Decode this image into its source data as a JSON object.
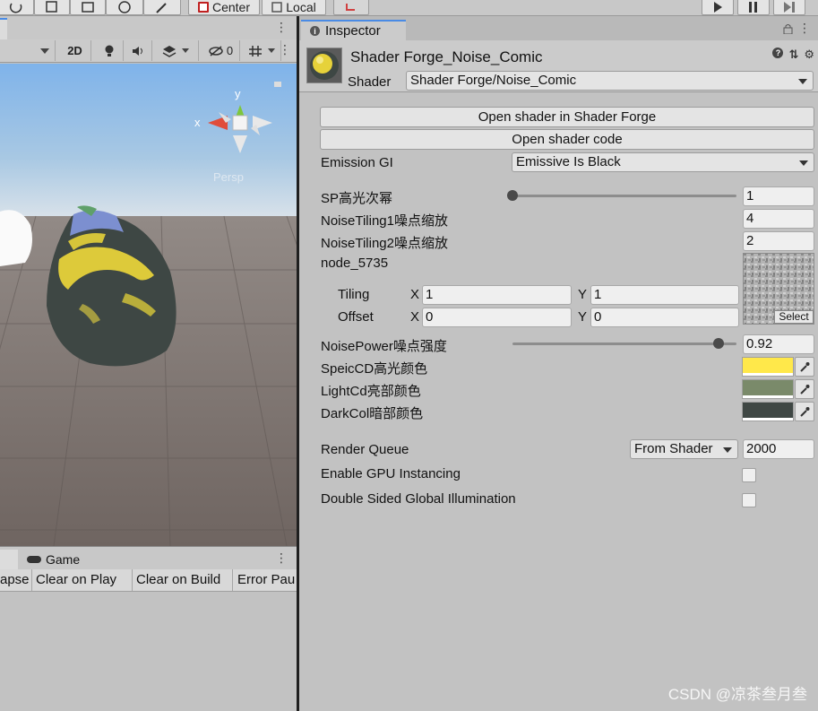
{
  "toolbar": {
    "pivot_center_label": "Center",
    "pivot_local_label": "Local"
  },
  "scene": {
    "toolbar": {
      "mode_2d": "2D",
      "hidden_count": "0"
    },
    "gizmo": {
      "y_label": "y",
      "x_label": "x",
      "persp_label": "Persp"
    }
  },
  "console": {
    "tab_game": "Game",
    "buttons": [
      "apse",
      "Clear on Play",
      "Clear on Build",
      "Error Pau"
    ]
  },
  "inspector": {
    "tab_label": "Inspector",
    "material_name": "Shader Forge_Noise_Comic",
    "shader_label": "Shader",
    "shader_value": "Shader Forge/Noise_Comic",
    "open_shader_button": "Open shader in Shader Forge",
    "open_code_button": "Open shader code",
    "emission_gi_label": "Emission GI",
    "emission_gi_value": "Emissive Is Black",
    "props": {
      "sp_label": "SP高光次幂",
      "sp_value": "1",
      "sp_slider": 0,
      "noise1_label": "NoiseTiling1噪点缩放",
      "noise1_value": "4",
      "noise2_label": "NoiseTiling2噪点缩放",
      "noise2_value": "2",
      "node_label": "node_5735",
      "tiling_label": "Tiling",
      "tiling_x": "1",
      "tiling_y": "1",
      "offset_label": "Offset",
      "offset_x": "0",
      "offset_y": "0",
      "x_axis": "X",
      "y_axis": "Y",
      "select_label": "Select",
      "noise_power_label": "NoisePower噪点强度",
      "noise_power_value": "0.92",
      "noise_power_slider": 0.92,
      "spec_color_label": "SpeicCD高光颜色",
      "light_color_label": "LightCd亮部颜色",
      "dark_color_label": "DarkCol暗部颜色"
    },
    "colors": {
      "spec": "#ffe84a",
      "light": "#7a8a6a",
      "dark": "#3f4744"
    },
    "render_queue_label": "Render Queue",
    "render_queue_mode": "From Shader",
    "render_queue_value": "2000",
    "gpu_instancing_label": "Enable GPU Instancing",
    "double_sided_gi_label": "Double Sided Global Illumination"
  },
  "watermark": "CSDN @凉茶叁月叁"
}
